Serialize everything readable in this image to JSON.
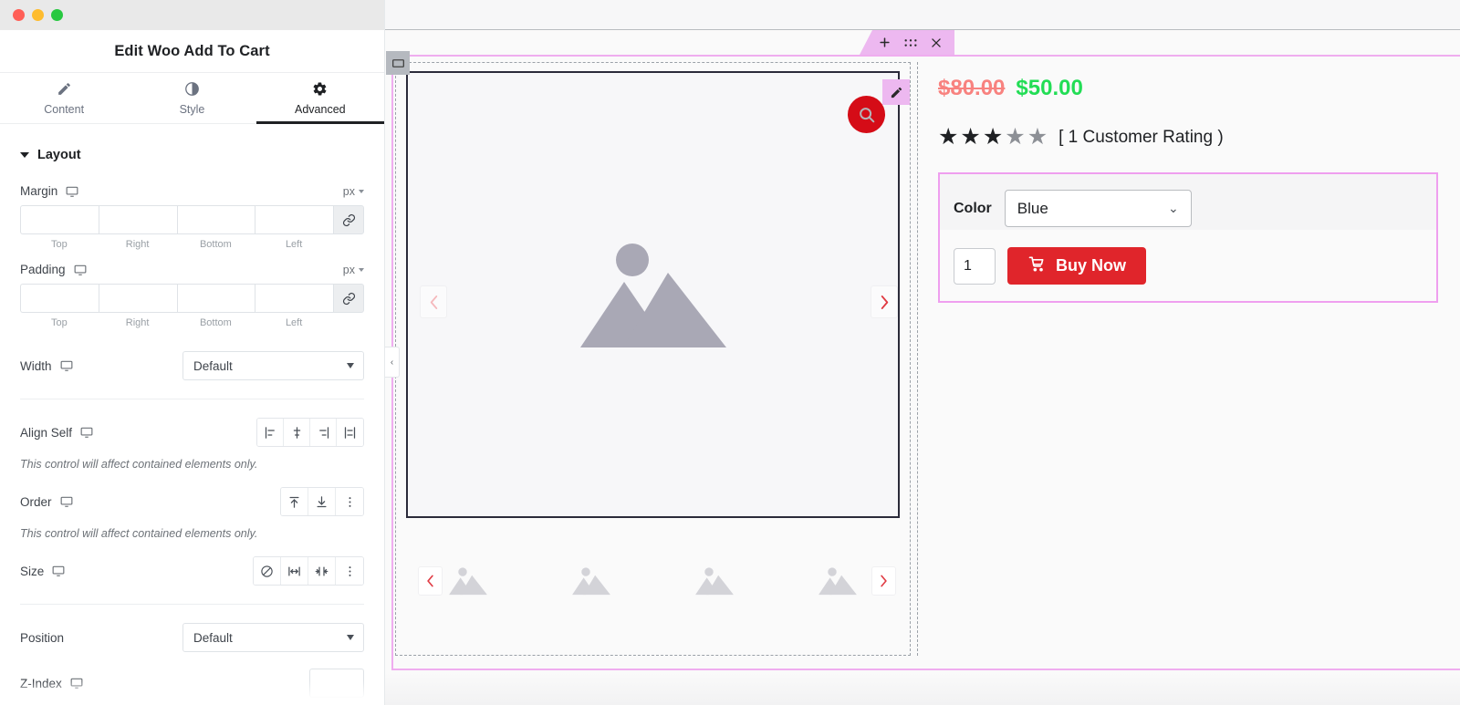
{
  "window": {
    "traffic_lights": [
      "close",
      "minimize",
      "maximize"
    ]
  },
  "panel": {
    "title": "Edit Woo Add To Cart",
    "tabs": [
      {
        "label": "Content",
        "icon": "pencil-icon",
        "active": false
      },
      {
        "label": "Style",
        "icon": "contrast-icon",
        "active": false
      },
      {
        "label": "Advanced",
        "icon": "gear-icon",
        "active": true
      }
    ],
    "section": {
      "title": "Layout",
      "margin": {
        "label": "Margin",
        "unit": "px",
        "values": [
          "",
          "",
          "",
          ""
        ],
        "sides": [
          "Top",
          "Right",
          "Bottom",
          "Left"
        ],
        "link_icon": "link-icon"
      },
      "padding": {
        "label": "Padding",
        "unit": "px",
        "values": [
          "",
          "",
          "",
          ""
        ],
        "sides": [
          "Top",
          "Right",
          "Bottom",
          "Left"
        ],
        "link_icon": "link-icon"
      },
      "width": {
        "label": "Width",
        "value": "Default"
      },
      "align_self": {
        "label": "Align Self",
        "hint": "This control will affect contained elements only.",
        "options": [
          "align-start",
          "align-center",
          "align-end",
          "align-stretch"
        ]
      },
      "order": {
        "label": "Order",
        "hint": "This control will affect contained elements only.",
        "options": [
          "order-start",
          "order-end",
          "order-more"
        ]
      },
      "size": {
        "label": "Size",
        "options": [
          "size-none",
          "size-grow",
          "size-shrink",
          "size-more"
        ]
      },
      "position": {
        "label": "Position",
        "value": "Default"
      },
      "z_index": {
        "label": "Z-Index",
        "value": ""
      }
    },
    "collapse_icon": "chevron-left-icon"
  },
  "canvas": {
    "element_toolbar": {
      "add": "+",
      "drag_icon": "drag-dots-icon",
      "close_icon": "close-icon"
    },
    "gallery": {
      "handle_icon": "column-handle-icon",
      "placeholder_icon": "image-placeholder-icon",
      "prev_arrow": "chevron-left-icon",
      "next_arrow": "chevron-right-icon",
      "zoom_icon": "magnifier-icon",
      "edit_icon": "pencil-edit-icon",
      "thumbnails": [
        "image-placeholder-icon",
        "image-placeholder-icon",
        "image-placeholder-icon",
        "image-placeholder-icon"
      ],
      "thumb_prev": "chevron-left-icon",
      "thumb_next": "chevron-right-icon"
    },
    "product": {
      "price_old": "$80.00",
      "price_new": "$50.00",
      "rating": {
        "filled": 3,
        "total": 5,
        "glyph": "★",
        "text": "[ 1 Customer Rating )"
      },
      "variation": {
        "label": "Color",
        "selected": "Blue",
        "chevron_icon": "chevron-down-icon"
      },
      "quantity": "1",
      "buy_button": {
        "label": "Buy Now",
        "icon": "cart-icon"
      }
    }
  },
  "colors": {
    "price_old": "#f8827f",
    "price_new": "#22dd55",
    "buy_button": "#e0252b",
    "accent_pink": "#edb8f0",
    "section_outline": "#ef9fef",
    "zoom_badge": "#d50c17"
  }
}
